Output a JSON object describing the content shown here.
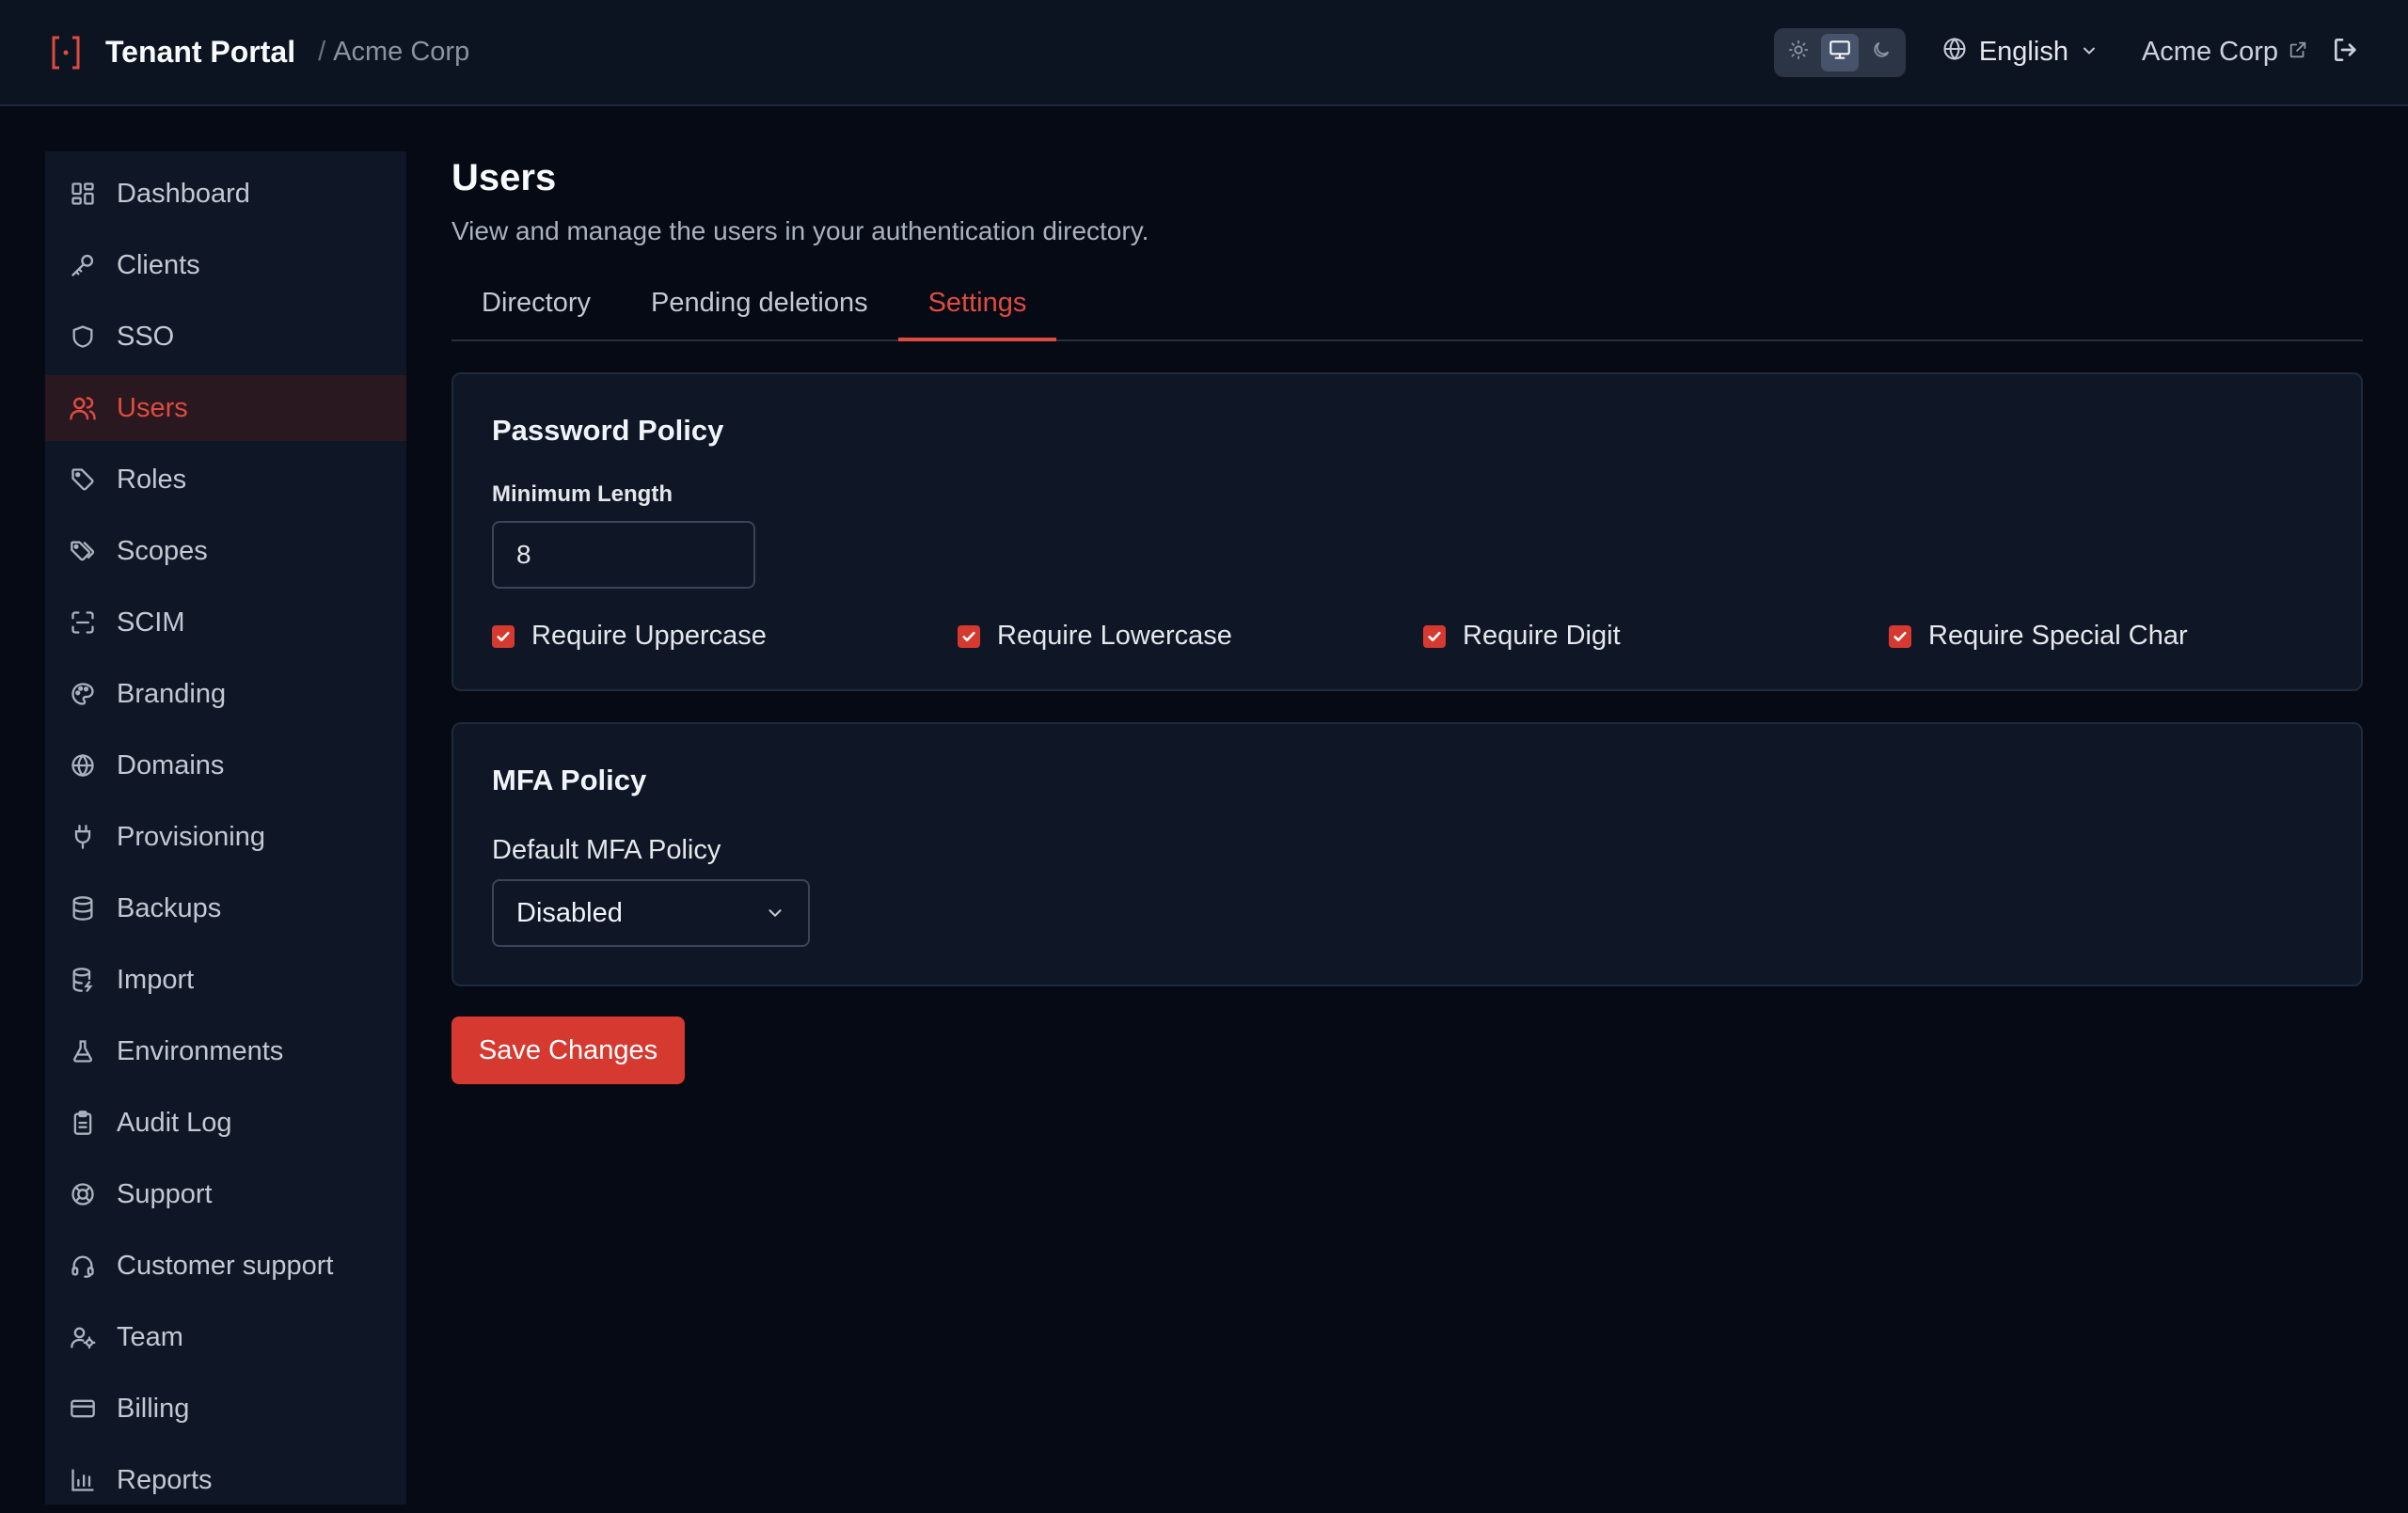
{
  "header": {
    "app_title": "Tenant Portal",
    "breadcrumb_sep": "/",
    "org_name": "Acme Corp",
    "language": "English",
    "org_link": "Acme Corp"
  },
  "sidebar": {
    "items": [
      {
        "label": "Dashboard",
        "icon": "dashboard-icon"
      },
      {
        "label": "Clients",
        "icon": "key-icon"
      },
      {
        "label": "SSO",
        "icon": "shield-icon"
      },
      {
        "label": "Users",
        "icon": "users-icon",
        "active": true
      },
      {
        "label": "Roles",
        "icon": "tag-icon"
      },
      {
        "label": "Scopes",
        "icon": "tags-icon"
      },
      {
        "label": "SCIM",
        "icon": "scan-icon"
      },
      {
        "label": "Branding",
        "icon": "palette-icon"
      },
      {
        "label": "Domains",
        "icon": "globe-icon"
      },
      {
        "label": "Provisioning",
        "icon": "plug-icon"
      },
      {
        "label": "Backups",
        "icon": "database-icon"
      },
      {
        "label": "Import",
        "icon": "database-import-icon"
      },
      {
        "label": "Environments",
        "icon": "flask-icon"
      },
      {
        "label": "Audit Log",
        "icon": "clipboard-icon"
      },
      {
        "label": "Support",
        "icon": "lifebuoy-icon"
      },
      {
        "label": "Customer support",
        "icon": "headset-icon"
      },
      {
        "label": "Team",
        "icon": "user-cog-icon"
      },
      {
        "label": "Billing",
        "icon": "credit-card-icon"
      },
      {
        "label": "Reports",
        "icon": "bar-chart-icon"
      }
    ]
  },
  "main": {
    "title": "Users",
    "subtitle": "View and manage the users in your authentication directory.",
    "tabs": [
      {
        "label": "Directory"
      },
      {
        "label": "Pending deletions"
      },
      {
        "label": "Settings",
        "active": true
      }
    ],
    "password_policy": {
      "title": "Password Policy",
      "min_length_label": "Minimum Length",
      "min_length_value": "8",
      "checks": [
        {
          "label": "Require Uppercase",
          "checked": true
        },
        {
          "label": "Require Lowercase",
          "checked": true
        },
        {
          "label": "Require Digit",
          "checked": true
        },
        {
          "label": "Require Special Char",
          "checked": true
        }
      ]
    },
    "mfa_policy": {
      "title": "MFA Policy",
      "default_label": "Default MFA Policy",
      "default_value": "Disabled"
    },
    "save_label": "Save Changes"
  },
  "colors": {
    "accent": "#d6392f",
    "background": "#050a14",
    "surface": "#0f1726"
  }
}
